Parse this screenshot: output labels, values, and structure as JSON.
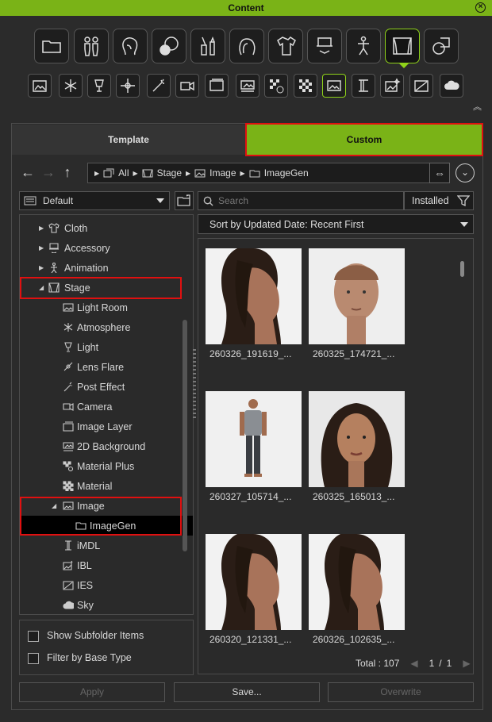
{
  "window": {
    "title": "Content"
  },
  "categories": [
    {
      "name": "folder-icon"
    },
    {
      "name": "avatar-icon"
    },
    {
      "name": "head-icon"
    },
    {
      "name": "skin-icon"
    },
    {
      "name": "makeup-icon"
    },
    {
      "name": "hair-icon"
    },
    {
      "name": "cloth-icon"
    },
    {
      "name": "accessory-icon"
    },
    {
      "name": "animation-icon"
    },
    {
      "name": "stage-icon",
      "active": true
    },
    {
      "name": "props-icon"
    }
  ],
  "subcategories": [
    {
      "name": "light-room-icon"
    },
    {
      "name": "atmosphere-icon"
    },
    {
      "name": "light-icon"
    },
    {
      "name": "lens-flare-icon"
    },
    {
      "name": "post-effect-icon"
    },
    {
      "name": "camera-icon"
    },
    {
      "name": "image-layer-icon"
    },
    {
      "name": "2d-background-icon"
    },
    {
      "name": "material-plus-icon"
    },
    {
      "name": "material-icon"
    },
    {
      "name": "image-icon",
      "active": true
    },
    {
      "name": "imdl-icon"
    },
    {
      "name": "ibl-icon"
    },
    {
      "name": "ies-icon"
    },
    {
      "name": "sky-icon"
    }
  ],
  "tabs": {
    "template": "Template",
    "custom": "Custom"
  },
  "breadcrumb": {
    "all": "All",
    "stage": "Stage",
    "image": "Image",
    "imagegen": "ImageGen"
  },
  "filter": {
    "dropdown": "Default"
  },
  "search": {
    "placeholder": "Search",
    "installed": "Installed"
  },
  "sort": {
    "label": "Sort by Updated Date: Recent First"
  },
  "tree": [
    {
      "label": "Cloth",
      "arrow": "▶"
    },
    {
      "label": "Accessory",
      "arrow": "▶"
    },
    {
      "label": "Animation",
      "arrow": "▶"
    },
    {
      "label": "Stage",
      "arrow": "◢"
    },
    {
      "label": "Light Room"
    },
    {
      "label": "Atmosphere"
    },
    {
      "label": "Light"
    },
    {
      "label": "Lens Flare"
    },
    {
      "label": "Post Effect"
    },
    {
      "label": "Camera"
    },
    {
      "label": "Image Layer"
    },
    {
      "label": "2D Background"
    },
    {
      "label": "Material Plus"
    },
    {
      "label": "Material"
    },
    {
      "label": "Image",
      "arrow": "◢"
    },
    {
      "label": "ImageGen"
    },
    {
      "label": "iMDL"
    },
    {
      "label": "IBL"
    },
    {
      "label": "IES"
    },
    {
      "label": "Sky"
    }
  ],
  "options": {
    "show_subfolder": "Show Subfolder Items",
    "filter_base": "Filter by Base Type"
  },
  "items": [
    {
      "label": "260326_191619_...",
      "kind": "profile-woman"
    },
    {
      "label": "260325_174721_...",
      "kind": "front-bald"
    },
    {
      "label": "260327_105714_...",
      "kind": "body-man"
    },
    {
      "label": "260325_165013_...",
      "kind": "front-woman"
    },
    {
      "label": "260320_121331_...",
      "kind": "profile-woman"
    },
    {
      "label": "260326_102635_...",
      "kind": "profile-woman"
    }
  ],
  "pagination": {
    "total": "Total : 107",
    "current": "1",
    "sep": "/",
    "pages": "1",
    "prev": "◀",
    "next": "▶"
  },
  "buttons": {
    "apply": "Apply",
    "save": "Save...",
    "overwrite": "Overwrite"
  },
  "colors": {
    "accent": "#7ab317",
    "highlight": "#e01010"
  }
}
